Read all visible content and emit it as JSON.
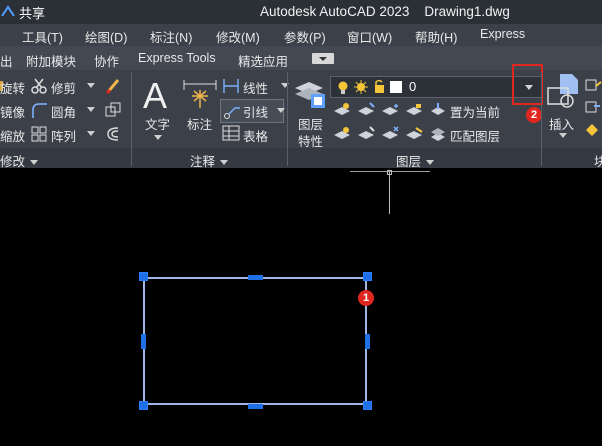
{
  "titlebar": {
    "share": "共享",
    "app_title": "Autodesk AutoCAD 2023",
    "file_title": "Drawing1.dwg"
  },
  "menus": [
    "工具(T)",
    "绘图(D)",
    "标注(N)",
    "修改(M)",
    "参数(P)",
    "窗口(W)",
    "帮助(H)",
    "Express"
  ],
  "tabs": [
    "出",
    "附加模块",
    "协作",
    "Express Tools",
    "精选应用"
  ],
  "modify_panel": {
    "items": [
      "旋转",
      "镜像",
      "缩放"
    ],
    "trim": "修剪",
    "fillet": "圆角",
    "array": "阵列",
    "title": "修改"
  },
  "annotation_panel": {
    "text": "文字",
    "dimension": "标注",
    "linear": "线性",
    "leader": "引线",
    "table": "表格",
    "title": "注释"
  },
  "layers_panel": {
    "layer_properties": [
      "图层",
      "特性"
    ],
    "current_layer": "0",
    "set_current": "置为当前",
    "match_layer": "匹配图层",
    "title": "图层"
  },
  "block_panel": {
    "insert": "插入",
    "title": "块"
  },
  "callouts": [
    "1",
    "2"
  ],
  "colors": {
    "accent_red": "#e0271f",
    "grip_blue": "#1f6fe6",
    "selection_line": "#9fb7e6"
  }
}
